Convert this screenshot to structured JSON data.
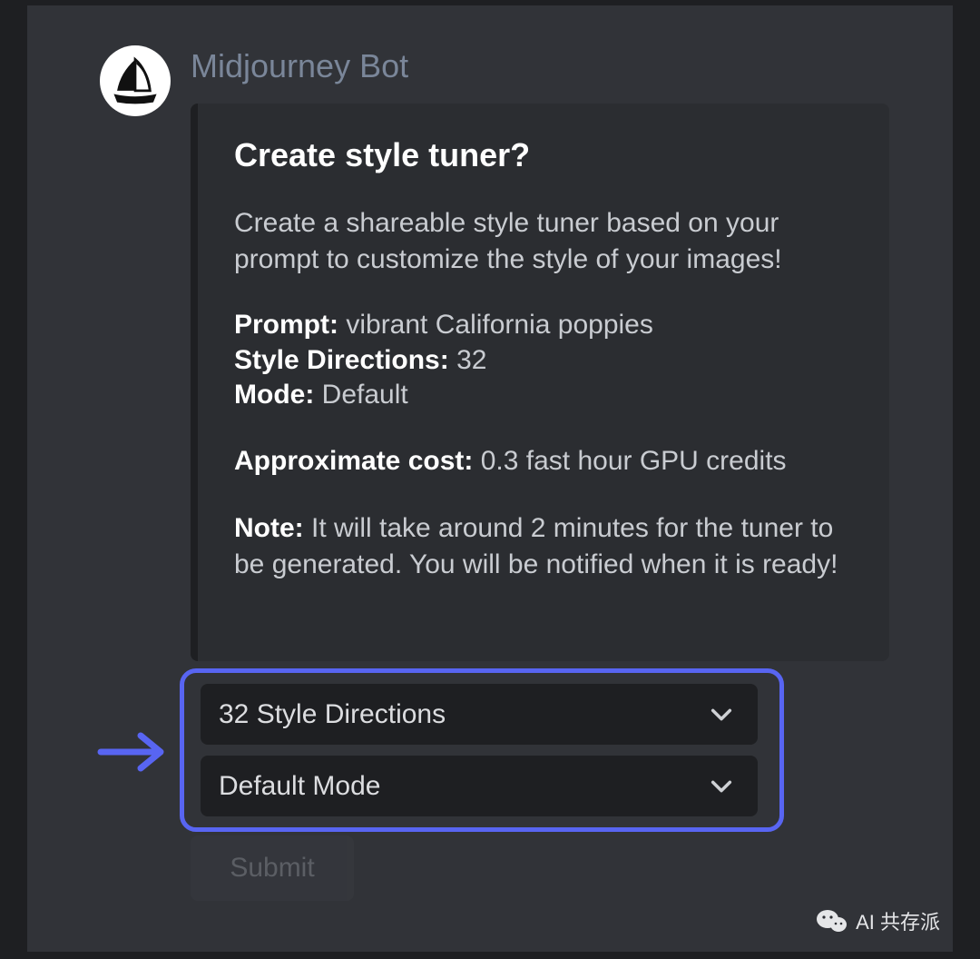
{
  "bot": {
    "name": "Midjourney Bot"
  },
  "embed": {
    "title": "Create style tuner?",
    "description": "Create a shareable style tuner based on your prompt to customize the style of your images!",
    "prompt_label": "Prompt:",
    "prompt_value": "vibrant California poppies",
    "style_directions_label": "Style Directions:",
    "style_directions_value": "32",
    "mode_label": "Mode:",
    "mode_value": "Default",
    "cost_label": "Approximate cost:",
    "cost_value": "0.3 fast hour GPU credits",
    "note_label": "Note:",
    "note_value": "It will take around 2 minutes for the tuner to be generated. You will be notified when it is ready!"
  },
  "dropdowns": {
    "style_directions": {
      "label": "32 Style Directions"
    },
    "mode": {
      "label": "Default Mode"
    }
  },
  "submit": {
    "label": "Submit"
  },
  "watermark": {
    "text": "AI 共存派"
  }
}
